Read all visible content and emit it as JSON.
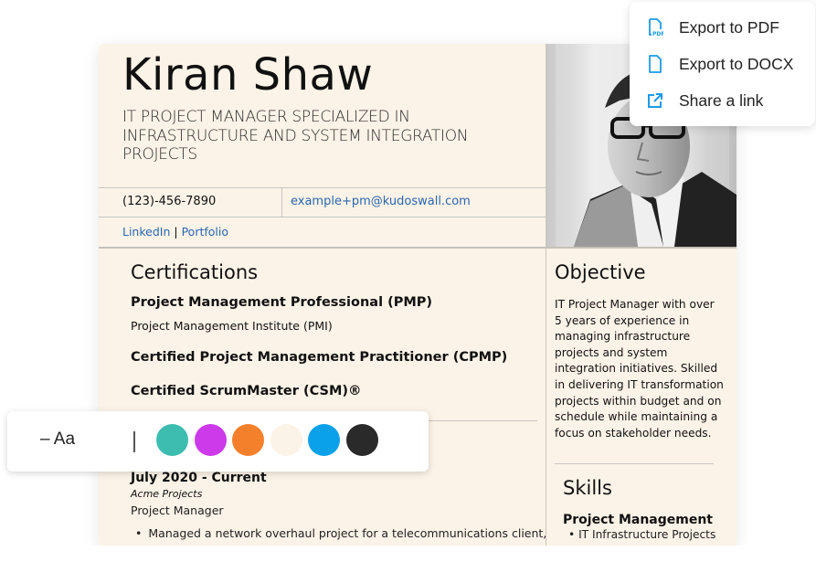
{
  "resume": {
    "name": "Kiran Shaw",
    "headline": "IT Project Manager specialized in infrastructure and system integration projects",
    "contact": {
      "phone": "(123)-456-7890",
      "email": "example+pm@kudoswall.com",
      "links": [
        {
          "label": "LinkedIn"
        },
        {
          "label": "Portfolio"
        }
      ],
      "link_separator": "|"
    },
    "photo": {
      "alt": "Portrait of Kiran Shaw",
      "style": "black-and-white"
    },
    "certifications": {
      "title": "Certifications",
      "items": [
        {
          "name": "Project Management Professional (PMP)",
          "issuer": "Project Management Institute (PMI)"
        },
        {
          "name": "Certified Project Management Practitioner (CPMP)",
          "issuer": ""
        },
        {
          "name": "Certified ScrumMaster (CSM)®",
          "issuer": ""
        }
      ]
    },
    "experience": {
      "items": [
        {
          "dates": "July 2020 - Current",
          "company": "Acme Projects",
          "role": "Project Manager",
          "bullets": [
            "Managed a network overhaul project for a telecommunications client,"
          ]
        }
      ]
    },
    "objective": {
      "title": "Objective",
      "text": "IT Project Manager with over 5 years of experience in managing infrastructure projects and system integration initiatives. Skilled in delivering IT transformation projects within budget and on schedule while maintaining a focus on stakeholder needs."
    },
    "skills": {
      "title": "Skills",
      "groups": [
        {
          "name": "Project Management",
          "items": [
            "IT Infrastructure Projects"
          ]
        }
      ]
    }
  },
  "export_menu": {
    "items": [
      {
        "label": "Export to PDF",
        "icon": "pdf-file-icon"
      },
      {
        "label": "Export to DOCX",
        "icon": "document-icon"
      },
      {
        "label": "Share a link",
        "icon": "external-link-icon"
      }
    ],
    "icon_color": "#1a9be8"
  },
  "style_toolbar": {
    "font_label": "– Aa",
    "swatches": [
      {
        "name": "teal",
        "color": "#3cbdb0"
      },
      {
        "name": "purple",
        "color": "#cc3aea"
      },
      {
        "name": "orange",
        "color": "#f5802b"
      },
      {
        "name": "cream",
        "color": "#fbf3e7"
      },
      {
        "name": "blue",
        "color": "#0ba0ea"
      },
      {
        "name": "black",
        "color": "#2a2a2a"
      }
    ]
  }
}
